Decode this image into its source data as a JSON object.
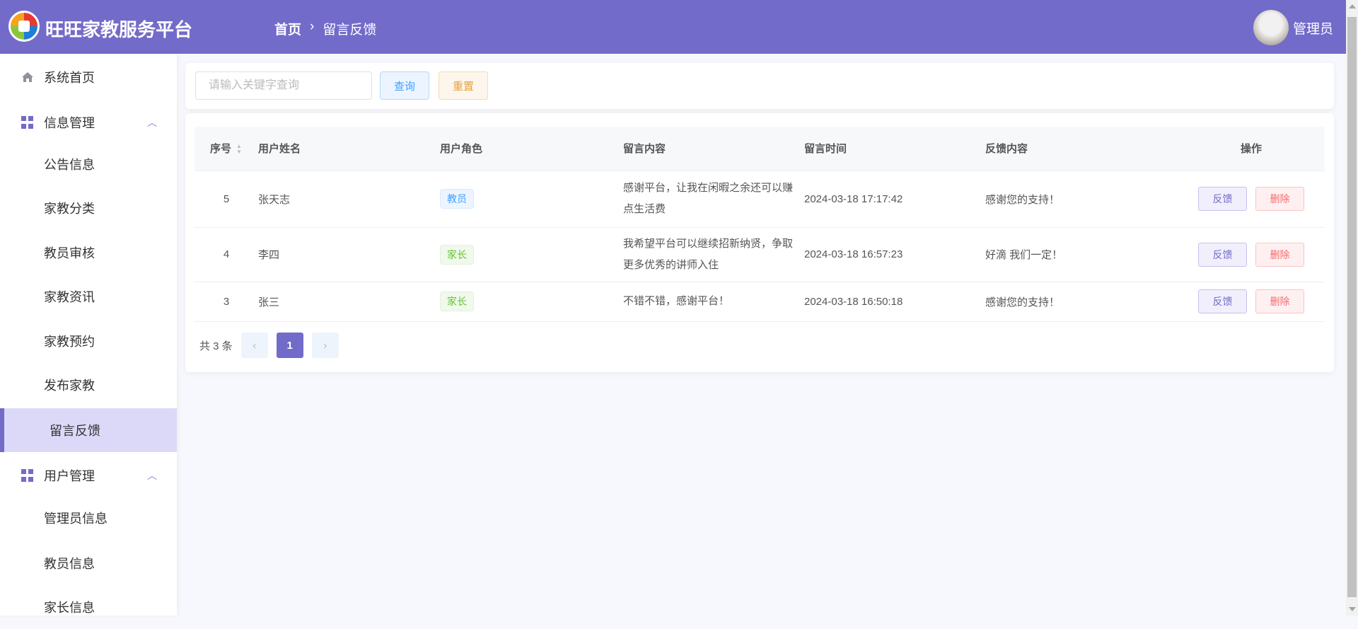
{
  "header": {
    "brand": "旺旺家教服务平台",
    "breadcrumb": [
      "首页",
      "留言反馈"
    ],
    "user": "管理员"
  },
  "sidebar": {
    "home": "系统首页",
    "group1": "信息管理",
    "group1_items": [
      "公告信息",
      "家教分类",
      "教员审核",
      "家教资讯",
      "家教预约",
      "发布家教",
      "留言反馈"
    ],
    "group2": "用户管理",
    "group2_items": [
      "管理员信息",
      "教员信息",
      "家长信息"
    ],
    "active": "留言反馈"
  },
  "search": {
    "placeholder": "请输入关键字查询",
    "query": "查询",
    "reset": "重置"
  },
  "table": {
    "headers": [
      "序号",
      "用户姓名",
      "用户角色",
      "留言内容",
      "留言时间",
      "反馈内容",
      "操作"
    ],
    "rows": [
      {
        "id": "5",
        "name": "张天志",
        "role": "教员",
        "content": "感谢平台，让我在闲暇之余还可以赚点生活费",
        "time": "2024-03-18 17:17:42",
        "reply": "感谢您的支持！"
      },
      {
        "id": "4",
        "name": "李四",
        "role": "家长",
        "content": "我希望平台可以继续招新纳贤，争取更多优秀的讲师入住",
        "time": "2024-03-18 16:57:23",
        "reply": "好滴 我们一定！"
      },
      {
        "id": "3",
        "name": "张三",
        "role": "家长",
        "content": "不错不错，感谢平台！",
        "time": "2024-03-18 16:50:18",
        "reply": "感谢您的支持！"
      }
    ],
    "actions": {
      "feedback": "反馈",
      "delete": "删除"
    }
  },
  "pagination": {
    "total": "共 3 条",
    "current": "1"
  },
  "colors": {
    "primary": "#736bc9",
    "active_bg": "#dcd9f8"
  }
}
